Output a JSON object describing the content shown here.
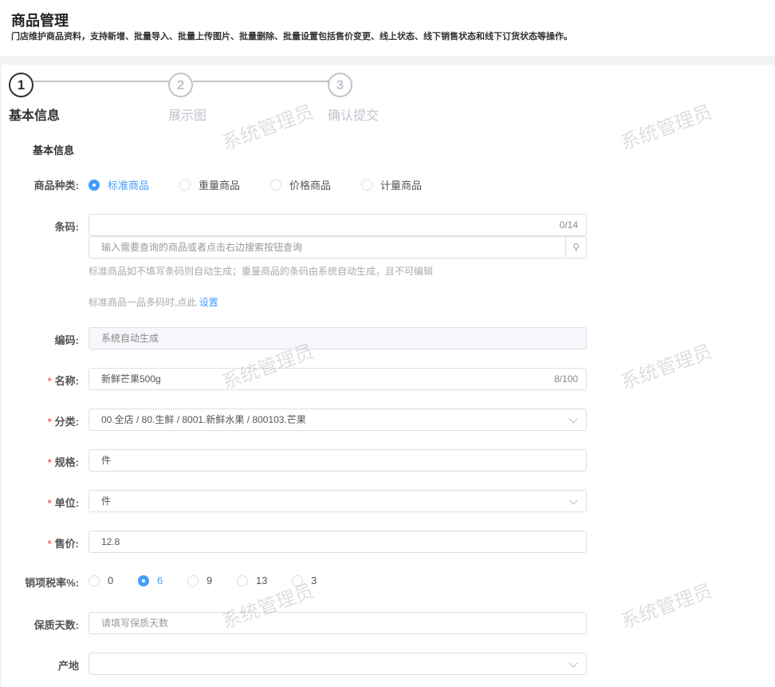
{
  "header": {
    "title": "商品管理",
    "description": "门店维护商品资料，支持新增、批量导入、批量上传图片、批量删除、批量设置包括售价变更、线上状态、线下销售状态和线下订货状态等操作。"
  },
  "steps": [
    {
      "num": "1",
      "label": "基本信息",
      "active": true
    },
    {
      "num": "2",
      "label": "展示图",
      "active": false
    },
    {
      "num": "3",
      "label": "确认提交",
      "active": false
    }
  ],
  "watermark": "系统管理员",
  "section_title": "基本信息",
  "form": {
    "type": {
      "label": "商品种类:",
      "options": [
        "标准商品",
        "重量商品",
        "价格商品",
        "计量商品"
      ],
      "selected": "标准商品"
    },
    "barcode": {
      "label": "条码:",
      "value": "",
      "counter": "0/14",
      "search_placeholder": "输入需要查询的商品或者点击右边搜索按钮查询",
      "help": "标准商品如不填写条码则自动生成；重量商品的条码由系统自动生成，且不可编辑",
      "multi_text": "标准商品一品多码时,点此",
      "multi_link": "设置"
    },
    "code": {
      "label": "编码:",
      "placeholder": "系统自动生成"
    },
    "name": {
      "label": "名称:",
      "value": "新鲜芒果500g",
      "counter": "8/100"
    },
    "category": {
      "label": "分类:",
      "value": "00.全店 / 80.生鲜 / 8001.新鲜水果 / 800103.芒果"
    },
    "spec": {
      "label": "规格:",
      "value": "件"
    },
    "unit": {
      "label": "单位:",
      "value": "件"
    },
    "price": {
      "label": "售价:",
      "value": "12.8"
    },
    "tax": {
      "label": "销项税率%:",
      "options": [
        "0",
        "6",
        "9",
        "13",
        "3"
      ],
      "selected": "6"
    },
    "shelf_life": {
      "label": "保质天数:",
      "placeholder": "请填写保质天数"
    },
    "origin": {
      "label": "产地",
      "value": ""
    }
  }
}
